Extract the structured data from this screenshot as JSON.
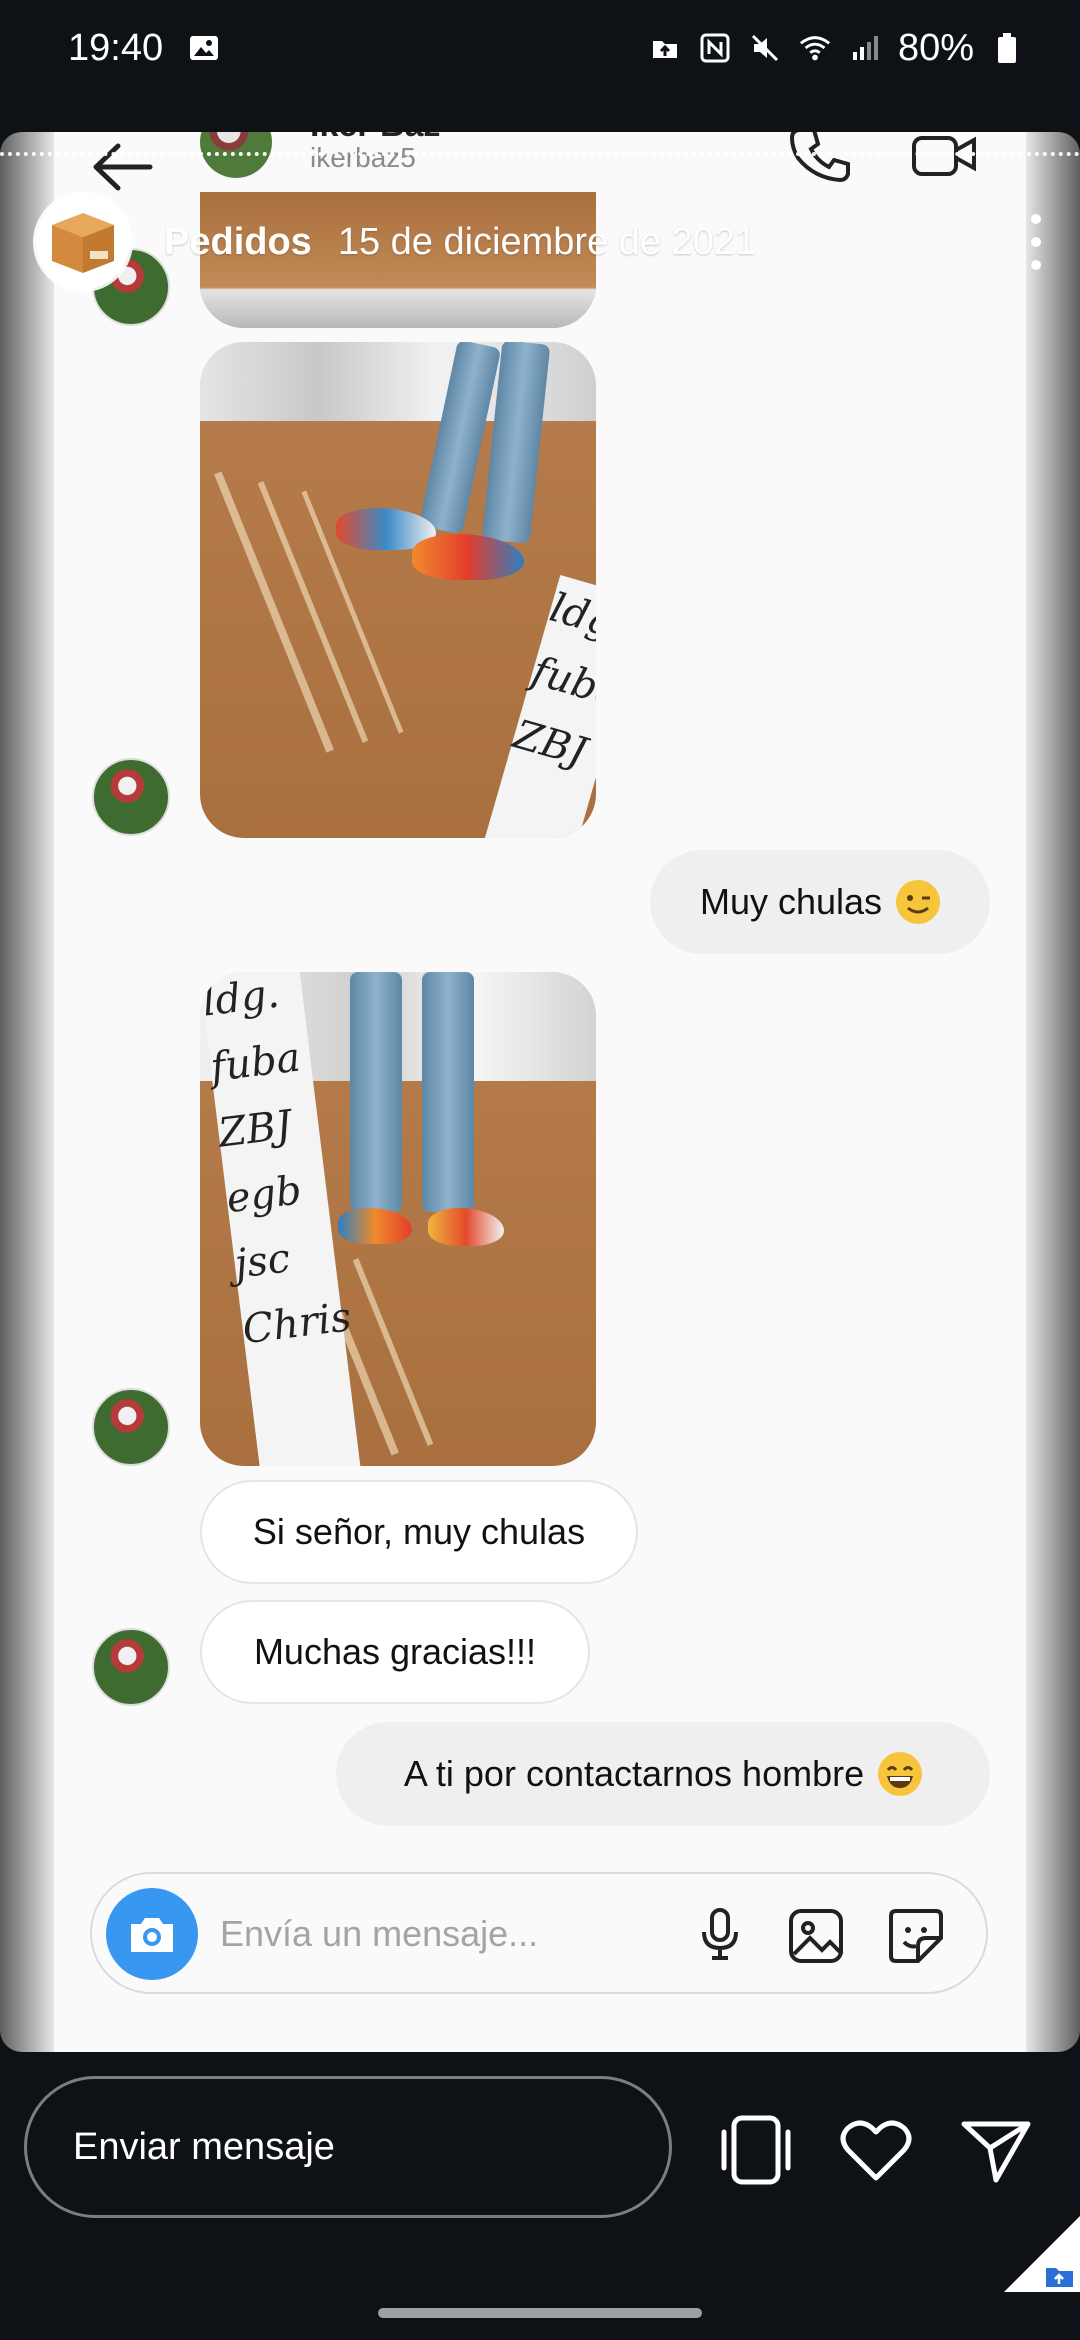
{
  "status_bar": {
    "time": "19:40",
    "battery": "80%",
    "icons": [
      "image-icon",
      "cloud-upload-icon",
      "nfc-icon",
      "mute-icon",
      "wifi-icon",
      "signal-icon",
      "battery-icon"
    ]
  },
  "dm_header": {
    "name": "Iker Baz",
    "username": "ikerbaz5"
  },
  "story": {
    "user": "Pedidos",
    "date": "15 de diciembre de 2021"
  },
  "messages": [
    {
      "type": "photo",
      "direction": "in"
    },
    {
      "type": "text",
      "direction": "out",
      "text": "Muy chulas",
      "emoji": "winking-face"
    },
    {
      "type": "photo",
      "direction": "in"
    },
    {
      "type": "text",
      "direction": "in",
      "text": "Si señor, muy chulas"
    },
    {
      "type": "text",
      "direction": "in",
      "text": "Muchas gracias!!!"
    },
    {
      "type": "text",
      "direction": "out",
      "text": "A ti por contactarnos hombre",
      "emoji": "grinning-face"
    }
  ],
  "photo_signatures": [
    "ldg.",
    "fuba",
    "ZBJ",
    "egb",
    "jsc",
    "Chris"
  ],
  "composer": {
    "placeholder": "Envía un mensaje..."
  },
  "reply_bar": {
    "placeholder": "Enviar mensaje"
  },
  "colors": {
    "accent": "#3897f0",
    "bubble_out": "#efefef",
    "background_dark": "#0e1116"
  }
}
